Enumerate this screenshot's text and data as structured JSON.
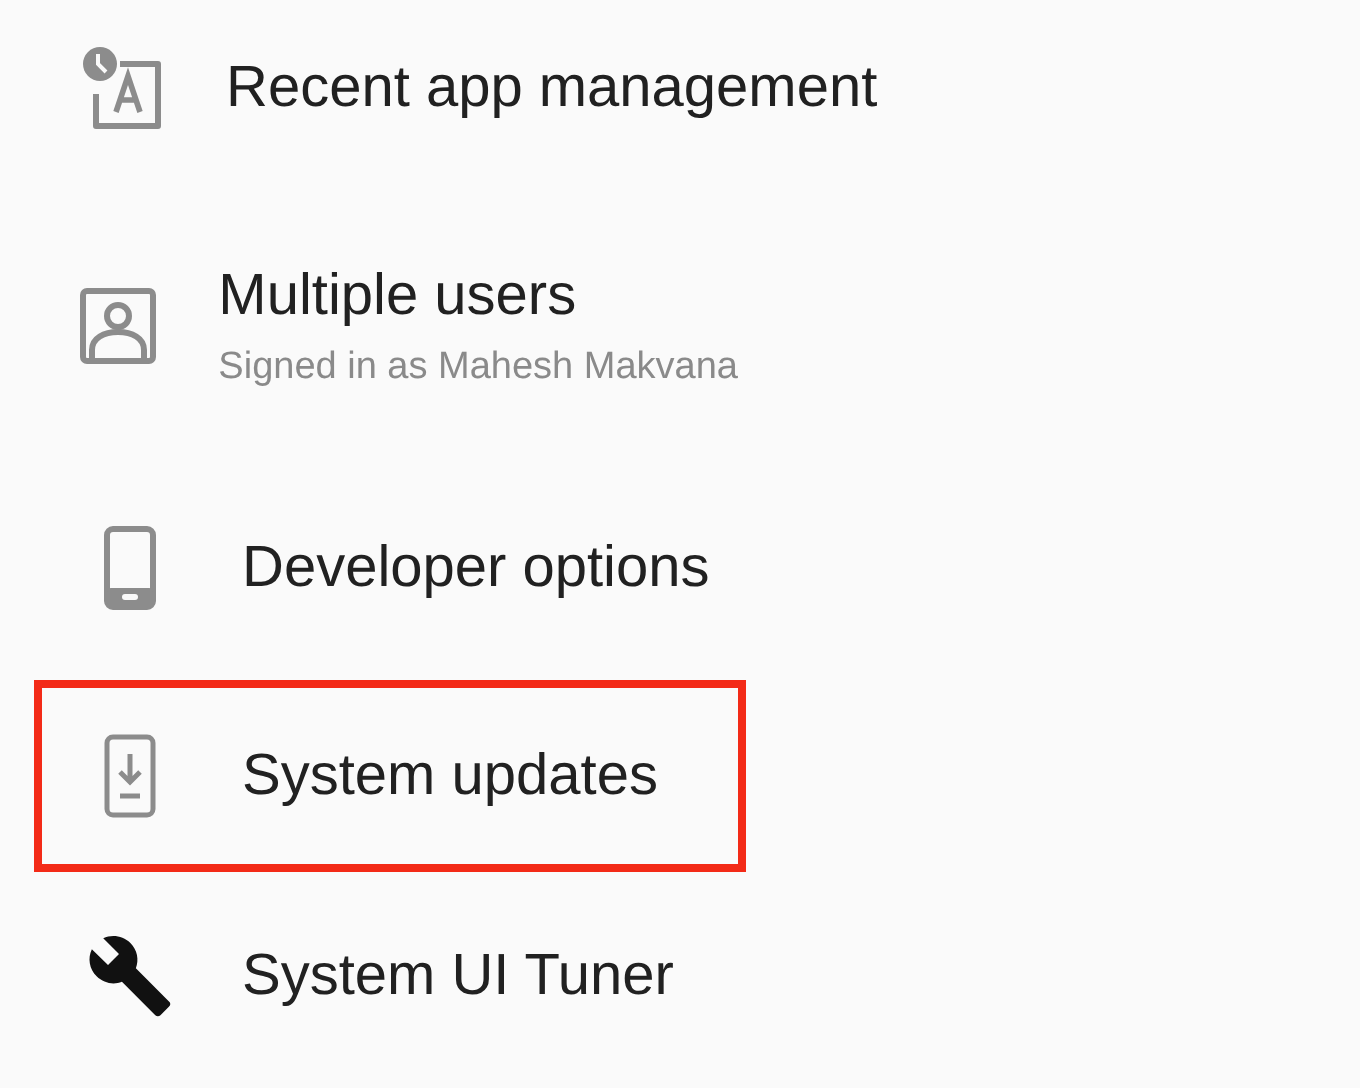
{
  "settings_items": [
    {
      "title": "Recent app management",
      "highlighted": false
    },
    {
      "title": "Multiple users",
      "subtitle": "Signed in as Mahesh Makvana",
      "highlighted": false
    },
    {
      "title": "Developer options",
      "highlighted": false
    },
    {
      "title": "System updates",
      "highlighted": true
    },
    {
      "title": "System UI Tuner",
      "highlighted": false
    }
  ]
}
